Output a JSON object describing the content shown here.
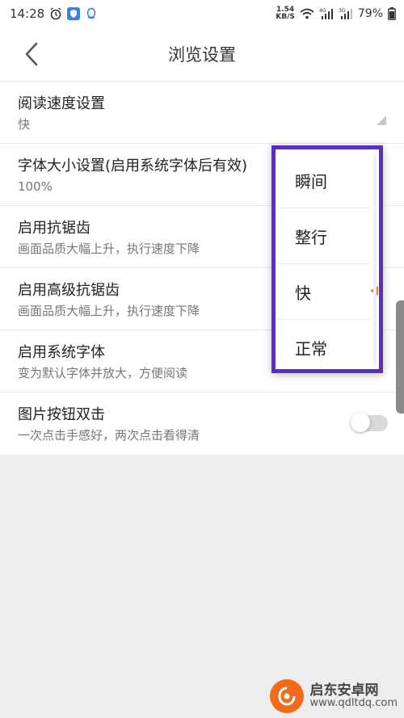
{
  "status_bar": {
    "time": "14:28",
    "net_speed_value": "1.54",
    "net_speed_unit": "KB/S",
    "battery": "79%"
  },
  "header": {
    "title": "浏览设置"
  },
  "settings": [
    {
      "title": "阅读速度设置",
      "subtitle": "快"
    },
    {
      "title": "字体大小设置(启用系统字体后有效)",
      "subtitle": "100%"
    },
    {
      "title": "启用抗锯齿",
      "subtitle": "画面品质大幅上升，执行速度下降"
    },
    {
      "title": "启用高级抗锯齿",
      "subtitle": "画面品质大幅上升，执行速度下降"
    },
    {
      "title": "启用系统字体",
      "subtitle": "变为默认字体并放大，方便阅读"
    },
    {
      "title": "图片按钮双击",
      "subtitle": "一次点击手感好，两次点击看得清"
    }
  ],
  "dropdown": {
    "options": [
      "瞬间",
      "整行",
      "快",
      "正常"
    ],
    "selected": "快"
  },
  "toggle_image_double_click": false,
  "watermark": {
    "name": "启东安卓网",
    "url": "www.qdltdq.com"
  },
  "colors": {
    "highlight_border": "#5b2fb8",
    "selected_marker": "#f07a3a",
    "watermark_logo": "#f26a1b"
  }
}
